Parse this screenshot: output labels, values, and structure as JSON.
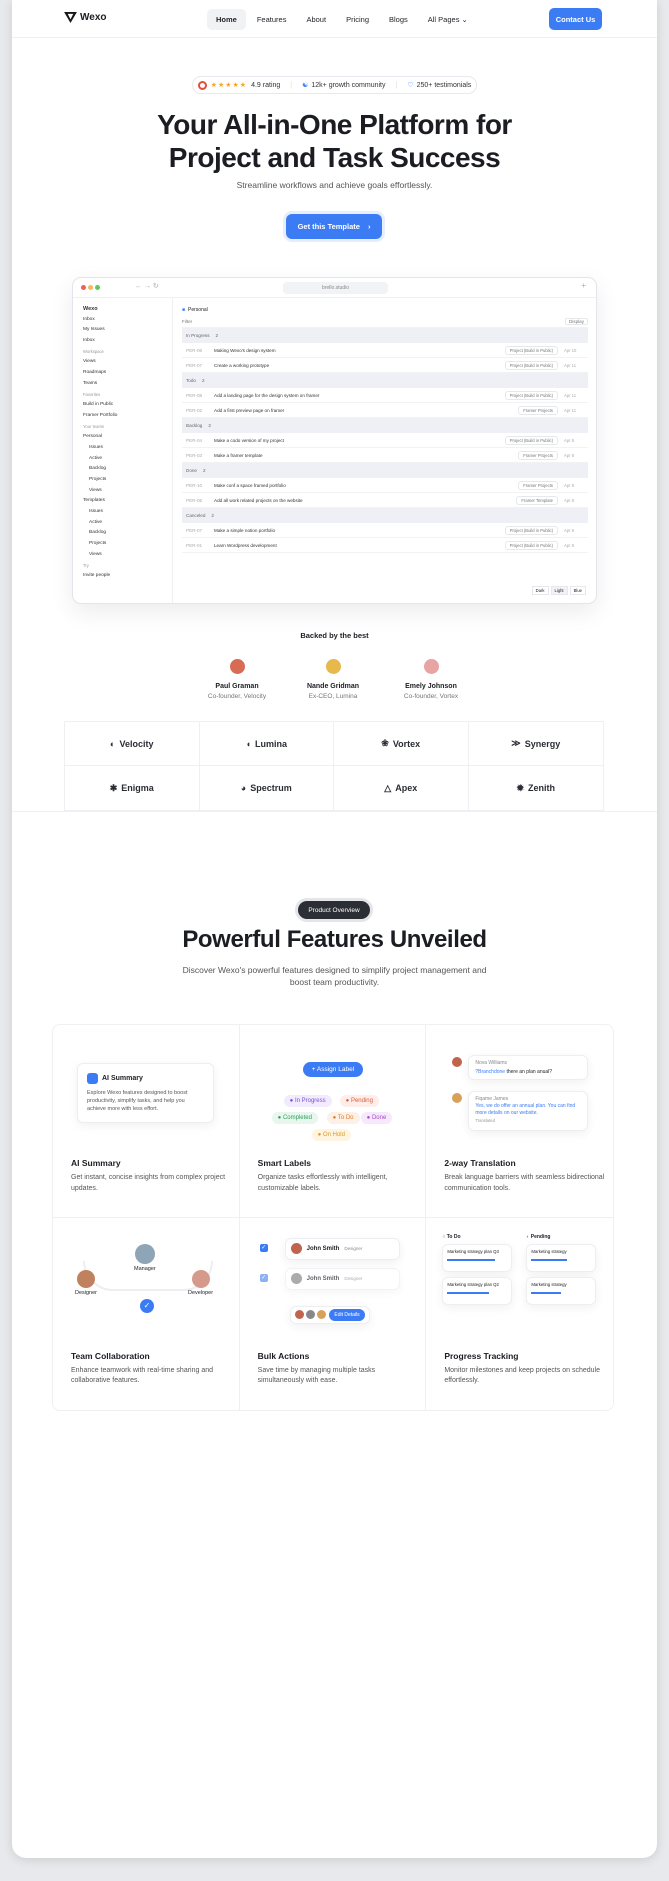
{
  "nav": {
    "brand": "Wexo",
    "links": [
      "Home",
      "Features",
      "About",
      "Pricing",
      "Blogs",
      "All Pages"
    ],
    "contact": "Contact Us"
  },
  "hero": {
    "rating": "4.9 rating",
    "community": "12k+ growth community",
    "testimonials": "250+ testimonials",
    "title_line1": "Your All-in-One Platform for",
    "title_line2": "Project and Task Success",
    "subtitle": "Streamline workflows and achieve goals effortlessly.",
    "cta": "Get this Template"
  },
  "app": {
    "url": "brello.studio",
    "brand": "Wexo",
    "sidebar": [
      {
        "t": "Inbox",
        "c": ""
      },
      {
        "t": "My Issues",
        "c": ""
      },
      {
        "t": "Inbox",
        "c": ""
      },
      {
        "t": "Workspace",
        "c": "sec"
      },
      {
        "t": "Views",
        "c": ""
      },
      {
        "t": "Roadmaps",
        "c": ""
      },
      {
        "t": "Teams",
        "c": ""
      },
      {
        "t": "Favorites",
        "c": "sec"
      },
      {
        "t": "Build in Public",
        "c": ""
      },
      {
        "t": "Framer Portfolio",
        "c": ""
      },
      {
        "t": "Your teams",
        "c": "sec"
      },
      {
        "t": "Personal",
        "c": ""
      },
      {
        "t": "Issues",
        "c": "in"
      },
      {
        "t": "Active",
        "c": "in"
      },
      {
        "t": "Backlog",
        "c": "in"
      },
      {
        "t": "Projects",
        "c": "in"
      },
      {
        "t": "Views",
        "c": "in"
      },
      {
        "t": "Templates",
        "c": ""
      },
      {
        "t": "Issues",
        "c": "in"
      },
      {
        "t": "Active",
        "c": "in"
      },
      {
        "t": "Backlog",
        "c": "in"
      },
      {
        "t": "Projects",
        "c": "in"
      },
      {
        "t": "Views",
        "c": "in"
      },
      {
        "t": "Try",
        "c": "sec"
      },
      {
        "t": "Invite people",
        "c": ""
      }
    ],
    "header": "Personal",
    "filter": "Filter",
    "display": "Display",
    "rows": [
      {
        "g": true,
        "t": "In Progress",
        "n": "2"
      },
      {
        "id": "PER-06",
        "t": "Making Wexo's design system",
        "tag": "Project (Build in Public)",
        "dt": "Apr 10"
      },
      {
        "id": "PER-07",
        "t": "Create a working prototype",
        "tag": "Project (Build in Public)",
        "dt": "Apr 11"
      },
      {
        "g": true,
        "t": "Todo",
        "n": "2"
      },
      {
        "id": "PER-08",
        "t": "Add a landing page for the design system on framer",
        "tag": "Project (Build in Public)",
        "dt": "Apr 11"
      },
      {
        "id": "PER-02",
        "t": "Add a first preview page on framer",
        "tag": "Framer Projects",
        "dt": "Apr 11"
      },
      {
        "g": true,
        "t": "Backlog",
        "n": "2"
      },
      {
        "id": "PER-04",
        "t": "Make a codo version of my project",
        "tag": "Project (Build in Public)",
        "dt": "Apr 8"
      },
      {
        "id": "PER-03",
        "t": "Make a framer template",
        "tag": "Framer Projects",
        "dt": "Apr 8"
      },
      {
        "g": true,
        "t": "Done",
        "n": "2"
      },
      {
        "id": "PER-10",
        "t": "Make conf a space framed portfolio",
        "tag": "Framer Projects",
        "dt": "Apr 8"
      },
      {
        "id": "PER-05",
        "t": "Add all work related projects on the website",
        "tag": "Framer Template",
        "dt": "Apr 8"
      },
      {
        "g": true,
        "t": "Canceled",
        "n": "2"
      },
      {
        "id": "PER-07",
        "t": "Make a simple notion portfolio",
        "tag": "Project (Build in Public)",
        "dt": "Apr 8"
      },
      {
        "id": "PER-01",
        "t": "Learn Wordpress development",
        "tag": "Project (Build in Public)",
        "dt": "Apr 8"
      }
    ],
    "footer": [
      "Dark",
      "Light",
      "Blue"
    ]
  },
  "backers": {
    "heading": "Backed by the best",
    "people": [
      {
        "name": "Paul Graman",
        "role": "Co-founder, Velocity",
        "color": "#d86b55"
      },
      {
        "name": "Nande Gridman",
        "role": "Ex-CEO, Lumina",
        "color": "#e7b84b"
      },
      {
        "name": "Emely Johnson",
        "role": "Co-founder, Vortex",
        "color": "#e7a4a0"
      }
    ],
    "logos": [
      "Velocity",
      "Lumina",
      "Vortex",
      "Synergy",
      "Enigma",
      "Spectrum",
      "Apex",
      "Zenith"
    ]
  },
  "features": {
    "badge": "Product Overview",
    "title": "Powerful Features Unveiled",
    "subtitle": "Discover Wexo's powerful features designed to simplify project management and boost team productivity.",
    "items": [
      {
        "title": "AI Summary",
        "desc": "Get instant, concise insights from complex project updates."
      },
      {
        "title": "Smart Labels",
        "desc": "Organize tasks effortlessly with intelligent, customizable labels."
      },
      {
        "title": "2-way Translation",
        "desc": "Break language barriers with seamless bidirectional communication tools."
      },
      {
        "title": "Team Collaboration",
        "desc": "Enhance teamwork with real-time sharing and collaborative features."
      },
      {
        "title": "Bulk Actions",
        "desc": "Save time by managing multiple tasks simultaneously with ease."
      },
      {
        "title": "Progress Tracking",
        "desc": "Monitor milestones and keep projects on schedule effortlessly."
      }
    ],
    "ai_card": {
      "title": "AI Summary",
      "text": "Explore Wexo features designed to boost productivity, simplify tasks, and help you achieve more with less effort."
    },
    "labels": {
      "assign": "Assign Label",
      "in_progress": "In Progress",
      "pending": "Pending",
      "completed": "Completed",
      "todo": "To Do",
      "done": "Done",
      "on_hold": "On Hold"
    },
    "chat": {
      "name1": "Nova Williams",
      "msg1_link": "?Branchdone",
      "msg1": "there an plan anual?",
      "name2": "Fiqame James",
      "msg2": "Yes, we do offer an annual plan. You can find more details on our website.",
      "translated": "Translated"
    },
    "team": {
      "manager": "Manager",
      "designer": "Designer",
      "developer": "Developer"
    },
    "bulk": {
      "p1": "John Smith",
      "r1": "Designer",
      "p2": "John Smith",
      "r2": "Designer",
      "edit": "Edit Details"
    },
    "progress": {
      "col1": "To Do",
      "col2": "Pending",
      "c1": "Marketing strategy plan Q3",
      "c2": "Marketing strategy plan Q2",
      "c3": "Marketing strategy",
      "c4": "Marketing strategy"
    }
  }
}
